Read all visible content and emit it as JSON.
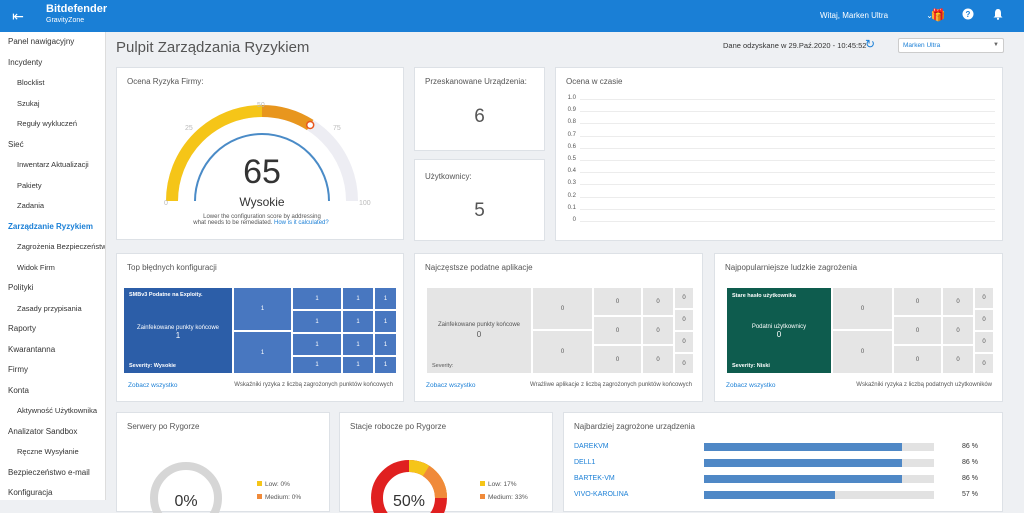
{
  "topbar": {
    "brand": "Bitdefender",
    "subbrand": "GravityZone",
    "welcome": "Witaj, Marken Ultra"
  },
  "sidebar": {
    "items": [
      {
        "label": "Panel nawigacyjny",
        "sub": false,
        "active": false
      },
      {
        "label": "Incydenty",
        "sub": false,
        "active": false
      },
      {
        "label": "Blocklist",
        "sub": true,
        "active": false
      },
      {
        "label": "Szukaj",
        "sub": true,
        "active": false
      },
      {
        "label": "Reguły wykluczeń",
        "sub": true,
        "active": false
      },
      {
        "label": "Sieć",
        "sub": false,
        "active": false
      },
      {
        "label": "Inwentarz Aktualizacji",
        "sub": true,
        "active": false
      },
      {
        "label": "Pakiety",
        "sub": true,
        "active": false
      },
      {
        "label": "Zadania",
        "sub": true,
        "active": false
      },
      {
        "label": "Zarządzanie Ryzykiem",
        "sub": false,
        "active": true
      },
      {
        "label": "Zagrożenia Bezpieczeństwa",
        "sub": true,
        "active": false
      },
      {
        "label": "Widok Firm",
        "sub": true,
        "active": false
      },
      {
        "label": "Polityki",
        "sub": false,
        "active": false
      },
      {
        "label": "Zasady przypisania",
        "sub": true,
        "active": false
      },
      {
        "label": "Raporty",
        "sub": false,
        "active": false
      },
      {
        "label": "Kwarantanna",
        "sub": false,
        "active": false
      },
      {
        "label": "Firmy",
        "sub": false,
        "active": false
      },
      {
        "label": "Konta",
        "sub": false,
        "active": false
      },
      {
        "label": "Aktywność Użytkownika",
        "sub": true,
        "active": false
      },
      {
        "label": "Analizator Sandbox",
        "sub": false,
        "active": false
      },
      {
        "label": "Ręczne Wysyłanie",
        "sub": true,
        "active": false
      },
      {
        "label": "Bezpieczeństwo e-mail",
        "sub": false,
        "active": false
      },
      {
        "label": "Konfiguracja",
        "sub": false,
        "active": false
      }
    ]
  },
  "header": {
    "title": "Pulpit Zarządzania Ryzykiem",
    "updated": "Dane odzyskane w 29.Paź.2020 - 10:45:52",
    "company": "Marken Ultra"
  },
  "risk": {
    "title": "Ocena Ryzyka Firmy:",
    "score": "65",
    "score_value": 65,
    "level": "Wysokie",
    "ticks": [
      "0",
      "25",
      "50",
      "75",
      "100"
    ],
    "note1": "Lower the configuration score by addressing",
    "note2": "what needs to be remediated.",
    "note_link": "How is it calculated?"
  },
  "scanned": {
    "title": "Przeskanowane Urządzenia:",
    "value": "6"
  },
  "users": {
    "title": "Użytkownicy:",
    "value": "5"
  },
  "over_time": {
    "title": "Ocena w czasie",
    "yticks": [
      "1.0",
      "0.9",
      "0.8",
      "0.7",
      "0.6",
      "0.5",
      "0.4",
      "0.3",
      "0.2",
      "0.1",
      "0"
    ]
  },
  "misconfig": {
    "title": "Top błędnych konfiguracji",
    "main_tile": {
      "head": "SMBv3 Podatne na Exploity.",
      "body": "Zainfekowane punkty końcowe",
      "count": "1",
      "severity": "Severity: Wysokie"
    },
    "tile_value": "1",
    "link": "Zobacz wszystko",
    "note": "Wskaźniki ryzyka z liczbą zagrożonych punktów końcowych"
  },
  "apps": {
    "title": "Najczęstsze podatne aplikacje",
    "main_tile": {
      "body": "Zainfekowane punkty końcowe",
      "count": "0",
      "severity": "Severity:"
    },
    "tile_value": "0",
    "link": "Zobacz wszystko",
    "note": "Wrażliwe aplikacje z liczbą zagrożonych punktów końcowych"
  },
  "human": {
    "title": "Najpopularniejsze ludzkie zagrożenia",
    "main_tile": {
      "head": "Stare hasło użytkownika",
      "body": "Podatni użytkownicy",
      "count": "0",
      "severity": "Severity: Niski"
    },
    "tile_value": "0",
    "link": "Zobacz wszystko",
    "note": "Wskaźniki ryzyka z liczbą podatnych użytkowników"
  },
  "servers": {
    "title": "Serwery po Rygorze",
    "pct": "0%",
    "low": "Low:  0%",
    "medium": "Medium: 0%"
  },
  "workstations": {
    "title": "Stacje robocze po Rygorze",
    "pct": "50%",
    "low": "Low:  17%",
    "medium": "Medium: 33%"
  },
  "devices": {
    "title": "Najbardziej zagrożone urządzenia",
    "rows": [
      {
        "name": "DAREKVM",
        "pct": "86 %",
        "value": 86
      },
      {
        "name": "DELL1",
        "pct": "86 %",
        "value": 86
      },
      {
        "name": "BARTEK-VM",
        "pct": "86 %",
        "value": 86
      },
      {
        "name": "VIVO-KAROLINA",
        "pct": "57 %",
        "value": 57
      }
    ]
  },
  "colors": {
    "accent": "#1a7fd6",
    "high": "#e8961e",
    "low": "#f5c518",
    "medium": "#f08a3a",
    "critical": "#e02020",
    "tile_blue": "#2c5ea8",
    "tile_green": "#0e5c4e"
  }
}
